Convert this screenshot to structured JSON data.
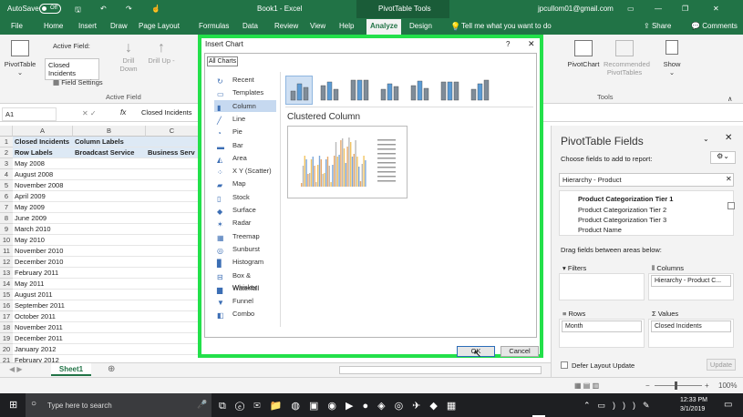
{
  "title_bar": {
    "autosave": "AutoSave",
    "autosave_state": "Off",
    "doc_title": "Book1 - Excel",
    "context_tab": "PivotTable Tools",
    "user": "jpcullom01@gmail.com"
  },
  "tabs": [
    "File",
    "Home",
    "Insert",
    "Draw",
    "Page Layout",
    "Formulas",
    "Data",
    "Review",
    "View",
    "Help",
    "Analyze",
    "Design"
  ],
  "tell_me": "Tell me what you want to do",
  "share": "Share",
  "comments": "Comments",
  "ribbon": {
    "pivottable": "PivotTable",
    "active_field_label": "Active Field:",
    "active_field_value": "Closed Incidents",
    "field_settings": "Field Settings",
    "drill_down": "Drill Down",
    "drill_up": "Drill Up -",
    "active_field_group": "Active Field",
    "pivotchart": "PivotChart",
    "recommended": "Recommended PivotTables",
    "show": "Show",
    "tools_group": "Tools"
  },
  "formula_bar": {
    "name_box": "A1",
    "fx": "fx",
    "value": "Closed Incidents"
  },
  "columns": [
    "A",
    "B",
    "C"
  ],
  "rows": [
    {
      "n": "1",
      "a": "Closed Incidents",
      "b": "Column Labels",
      "c": ""
    },
    {
      "n": "2",
      "a": "Row Labels",
      "b": "Broadcast Service",
      "c": "Business Serv"
    },
    {
      "n": "3",
      "a": "May 2008",
      "b": "",
      "c": ""
    },
    {
      "n": "4",
      "a": "August 2008",
      "b": "",
      "c": ""
    },
    {
      "n": "5",
      "a": "November 2008",
      "b": "",
      "c": ""
    },
    {
      "n": "6",
      "a": "April 2009",
      "b": "",
      "c": ""
    },
    {
      "n": "7",
      "a": "May 2009",
      "b": "",
      "c": ""
    },
    {
      "n": "8",
      "a": "June 2009",
      "b": "",
      "c": ""
    },
    {
      "n": "9",
      "a": "March 2010",
      "b": "",
      "c": ""
    },
    {
      "n": "10",
      "a": "May 2010",
      "b": "",
      "c": ""
    },
    {
      "n": "11",
      "a": "November 2010",
      "b": "",
      "c": ""
    },
    {
      "n": "12",
      "a": "December 2010",
      "b": "",
      "c": ""
    },
    {
      "n": "13",
      "a": "February 2011",
      "b": "",
      "c": ""
    },
    {
      "n": "14",
      "a": "May 2011",
      "b": "",
      "c": ""
    },
    {
      "n": "15",
      "a": "August 2011",
      "b": "",
      "c": ""
    },
    {
      "n": "16",
      "a": "September 2011",
      "b": "",
      "c": ""
    },
    {
      "n": "17",
      "a": "October 2011",
      "b": "",
      "c": ""
    },
    {
      "n": "18",
      "a": "November 2011",
      "b": "",
      "c": ""
    },
    {
      "n": "19",
      "a": "December 2011",
      "b": "",
      "c": ""
    },
    {
      "n": "20",
      "a": "January 2012",
      "b": "",
      "c": ""
    },
    {
      "n": "21",
      "a": "February 2012",
      "b": "",
      "c": ""
    }
  ],
  "sheet_tab": "Sheet1",
  "dialog": {
    "title": "Insert Chart",
    "help": "?",
    "close": "✕",
    "tab": "All Charts",
    "subtype_title": "Clustered Column",
    "ok": "OK",
    "cancel": "Cancel",
    "types": [
      "Recent",
      "Templates",
      "Column",
      "Line",
      "Pie",
      "Bar",
      "Area",
      "X Y (Scatter)",
      "Map",
      "Stock",
      "Surface",
      "Radar",
      "Treemap",
      "Sunburst",
      "Histogram",
      "Box & Whisker",
      "Waterfall",
      "Funnel",
      "Combo"
    ],
    "selected_type": "Column"
  },
  "pane": {
    "title": "PivotTable Fields",
    "choose": "Choose fields to add to report:",
    "search": "Hierarchy - Product",
    "fields": [
      "Product Categorization Tier 1",
      "Product Categorization Tier 2",
      "Product Categorization Tier 3",
      "Product Name"
    ],
    "drag": "Drag fields between areas below:",
    "filters": "Filters",
    "columns": "Columns",
    "columns_value": "Hierarchy - Product C...",
    "rows": "Rows",
    "rows_value": "Month",
    "values": "Values",
    "values_value": "Closed Incidents",
    "defer": "Defer Layout Update",
    "update": "Update"
  },
  "status": {
    "zoom": "100%"
  },
  "taskbar": {
    "search": "Type here to search",
    "time": "12:33 PM",
    "date": "3/1/2019"
  }
}
